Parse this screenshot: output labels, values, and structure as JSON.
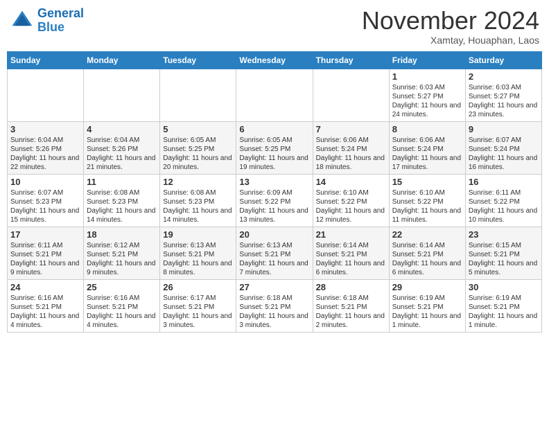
{
  "header": {
    "logo_line1": "General",
    "logo_line2": "Blue",
    "month": "November 2024",
    "location": "Xamtay, Houaphan, Laos"
  },
  "weekdays": [
    "Sunday",
    "Monday",
    "Tuesday",
    "Wednesday",
    "Thursday",
    "Friday",
    "Saturday"
  ],
  "weeks": [
    [
      {
        "day": "",
        "info": ""
      },
      {
        "day": "",
        "info": ""
      },
      {
        "day": "",
        "info": ""
      },
      {
        "day": "",
        "info": ""
      },
      {
        "day": "",
        "info": ""
      },
      {
        "day": "1",
        "info": "Sunrise: 6:03 AM\nSunset: 5:27 PM\nDaylight: 11 hours and 24 minutes."
      },
      {
        "day": "2",
        "info": "Sunrise: 6:03 AM\nSunset: 5:27 PM\nDaylight: 11 hours and 23 minutes."
      }
    ],
    [
      {
        "day": "3",
        "info": "Sunrise: 6:04 AM\nSunset: 5:26 PM\nDaylight: 11 hours and 22 minutes."
      },
      {
        "day": "4",
        "info": "Sunrise: 6:04 AM\nSunset: 5:26 PM\nDaylight: 11 hours and 21 minutes."
      },
      {
        "day": "5",
        "info": "Sunrise: 6:05 AM\nSunset: 5:25 PM\nDaylight: 11 hours and 20 minutes."
      },
      {
        "day": "6",
        "info": "Sunrise: 6:05 AM\nSunset: 5:25 PM\nDaylight: 11 hours and 19 minutes."
      },
      {
        "day": "7",
        "info": "Sunrise: 6:06 AM\nSunset: 5:24 PM\nDaylight: 11 hours and 18 minutes."
      },
      {
        "day": "8",
        "info": "Sunrise: 6:06 AM\nSunset: 5:24 PM\nDaylight: 11 hours and 17 minutes."
      },
      {
        "day": "9",
        "info": "Sunrise: 6:07 AM\nSunset: 5:24 PM\nDaylight: 11 hours and 16 minutes."
      }
    ],
    [
      {
        "day": "10",
        "info": "Sunrise: 6:07 AM\nSunset: 5:23 PM\nDaylight: 11 hours and 15 minutes."
      },
      {
        "day": "11",
        "info": "Sunrise: 6:08 AM\nSunset: 5:23 PM\nDaylight: 11 hours and 14 minutes."
      },
      {
        "day": "12",
        "info": "Sunrise: 6:08 AM\nSunset: 5:23 PM\nDaylight: 11 hours and 14 minutes."
      },
      {
        "day": "13",
        "info": "Sunrise: 6:09 AM\nSunset: 5:22 PM\nDaylight: 11 hours and 13 minutes."
      },
      {
        "day": "14",
        "info": "Sunrise: 6:10 AM\nSunset: 5:22 PM\nDaylight: 11 hours and 12 minutes."
      },
      {
        "day": "15",
        "info": "Sunrise: 6:10 AM\nSunset: 5:22 PM\nDaylight: 11 hours and 11 minutes."
      },
      {
        "day": "16",
        "info": "Sunrise: 6:11 AM\nSunset: 5:22 PM\nDaylight: 11 hours and 10 minutes."
      }
    ],
    [
      {
        "day": "17",
        "info": "Sunrise: 6:11 AM\nSunset: 5:21 PM\nDaylight: 11 hours and 9 minutes."
      },
      {
        "day": "18",
        "info": "Sunrise: 6:12 AM\nSunset: 5:21 PM\nDaylight: 11 hours and 9 minutes."
      },
      {
        "day": "19",
        "info": "Sunrise: 6:13 AM\nSunset: 5:21 PM\nDaylight: 11 hours and 8 minutes."
      },
      {
        "day": "20",
        "info": "Sunrise: 6:13 AM\nSunset: 5:21 PM\nDaylight: 11 hours and 7 minutes."
      },
      {
        "day": "21",
        "info": "Sunrise: 6:14 AM\nSunset: 5:21 PM\nDaylight: 11 hours and 6 minutes."
      },
      {
        "day": "22",
        "info": "Sunrise: 6:14 AM\nSunset: 5:21 PM\nDaylight: 11 hours and 6 minutes."
      },
      {
        "day": "23",
        "info": "Sunrise: 6:15 AM\nSunset: 5:21 PM\nDaylight: 11 hours and 5 minutes."
      }
    ],
    [
      {
        "day": "24",
        "info": "Sunrise: 6:16 AM\nSunset: 5:21 PM\nDaylight: 11 hours and 4 minutes."
      },
      {
        "day": "25",
        "info": "Sunrise: 6:16 AM\nSunset: 5:21 PM\nDaylight: 11 hours and 4 minutes."
      },
      {
        "day": "26",
        "info": "Sunrise: 6:17 AM\nSunset: 5:21 PM\nDaylight: 11 hours and 3 minutes."
      },
      {
        "day": "27",
        "info": "Sunrise: 6:18 AM\nSunset: 5:21 PM\nDaylight: 11 hours and 3 minutes."
      },
      {
        "day": "28",
        "info": "Sunrise: 6:18 AM\nSunset: 5:21 PM\nDaylight: 11 hours and 2 minutes."
      },
      {
        "day": "29",
        "info": "Sunrise: 6:19 AM\nSunset: 5:21 PM\nDaylight: 11 hours and 1 minute."
      },
      {
        "day": "30",
        "info": "Sunrise: 6:19 AM\nSunset: 5:21 PM\nDaylight: 11 hours and 1 minute."
      }
    ]
  ]
}
